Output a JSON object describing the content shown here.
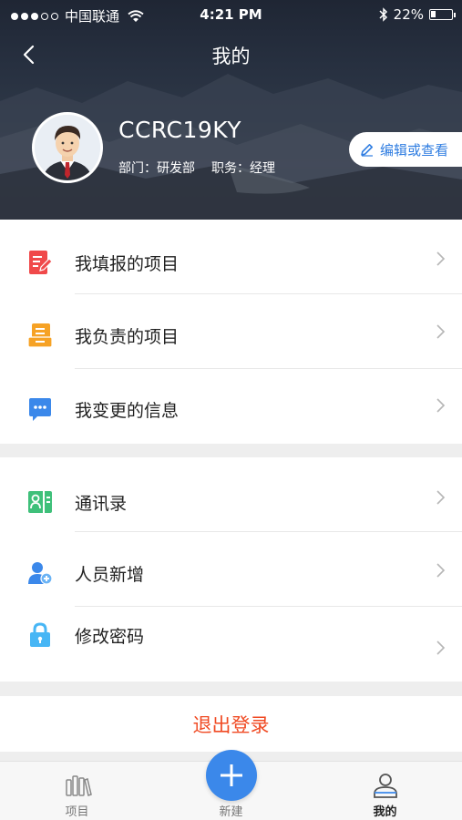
{
  "status_bar": {
    "carrier": "中国联通",
    "time": "4:21 PM",
    "battery_percent_text": "22%",
    "battery_level": 0.22,
    "signal_dots_filled": 3,
    "signal_dots_total": 5
  },
  "nav": {
    "title": "我的",
    "back_icon": "chevron-left-icon"
  },
  "profile": {
    "username": "CCRC19KY",
    "department_label": "部门：研发部",
    "position_label": "职务：经理",
    "edit_button_label": "编辑或查看",
    "edit_icon": "pencil-icon"
  },
  "menu_group_1": [
    {
      "label": "我填报的项目",
      "icon": "form-edit-icon",
      "color": "#f0494a"
    },
    {
      "label": "我负责的项目",
      "icon": "document-stack-icon",
      "color": "#f6a225"
    },
    {
      "label": "我变更的信息",
      "icon": "chat-bubble-icon",
      "color": "#3b88ea"
    }
  ],
  "menu_group_2": [
    {
      "label": "通讯录",
      "icon": "contacts-icon",
      "color": "#3fc07a"
    },
    {
      "label": "人员新增",
      "icon": "user-add-icon",
      "color": "#3b88ea"
    },
    {
      "label": "修改密码",
      "icon": "lock-icon",
      "color": "#47b6f5"
    }
  ],
  "logout_label": "退出登录",
  "tabbar": {
    "tabs": [
      {
        "label": "项目",
        "icon": "books-icon",
        "active": false
      },
      {
        "label": "新建",
        "icon": "plus-icon",
        "active": false
      },
      {
        "label": "我的",
        "icon": "person-icon",
        "active": true
      }
    ]
  },
  "colors": {
    "accent": "#3b88ea",
    "logout": "#f04a23",
    "header_bg": "#273040"
  }
}
